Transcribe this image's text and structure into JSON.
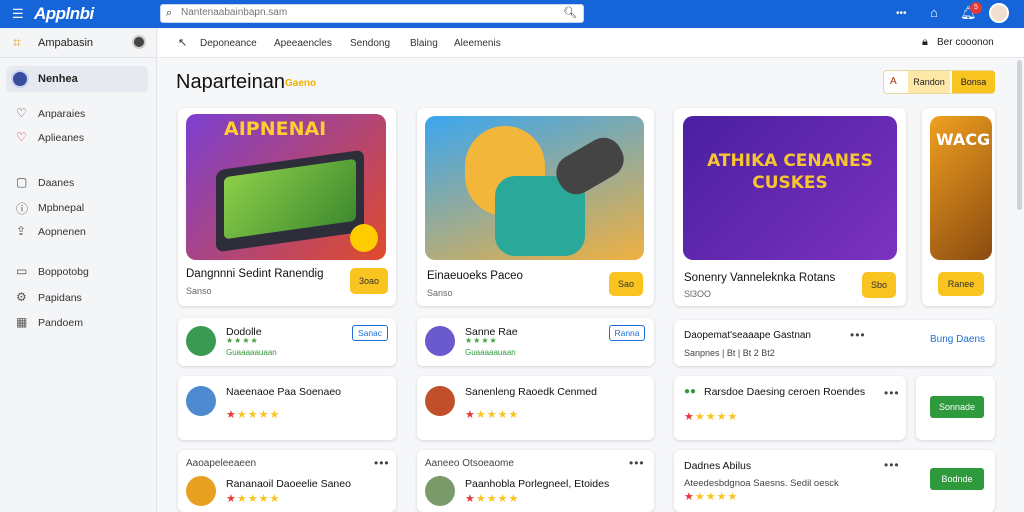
{
  "topbar": {
    "logo": "Applnbi",
    "search_placeholder": "Nantenaabainbapn.sam",
    "icons": [
      "menu-icon",
      "search-icon",
      "more-icon",
      "home-icon",
      "bell-icon",
      "avatar"
    ],
    "more": "•••",
    "bell_count": "5",
    "brand_color": "#1565d8"
  },
  "sidebar": {
    "header_label": "Ampabasin",
    "active_label": "Nenhea",
    "items": [
      {
        "label": "Anparaies",
        "icon": "heart-icon"
      },
      {
        "label": "Aplieanes",
        "icon": "heart-red-icon"
      },
      {
        "label": "Daanes",
        "icon": "box-icon"
      },
      {
        "label": "Mpbnepal",
        "icon": "info-icon"
      },
      {
        "label": "Aopnenen",
        "icon": "upload-icon"
      },
      {
        "label": "Boppotobg",
        "icon": "folder-icon"
      },
      {
        "label": "Papidans",
        "icon": "gear-icon"
      },
      {
        "label": "Pandoem",
        "icon": "calendar-icon"
      }
    ]
  },
  "subnav": {
    "tabs": [
      "Deponeance",
      "Apeeaencles",
      "Sendong",
      "Blaing",
      "Aleemenis"
    ],
    "right_label": "Ber cooonon"
  },
  "main": {
    "title": "Naparteinan",
    "title_badge": "Gaeno",
    "segment": {
      "icon_text": "A",
      "opt1": "Randon",
      "opt2": "Bonsa"
    }
  },
  "hero_cards": [
    {
      "image_text": "AIPNENAI",
      "title": "Dangnnni Sedint Ranendig",
      "sub": "Sanso",
      "button": "3oao"
    },
    {
      "image_text": "",
      "title": "Einaeuoeks Paceo",
      "sub": "Sanso",
      "button": "Sao"
    },
    {
      "image_text": "ATHIKA CENANES CUSKES",
      "title": "Sonenry Vanneleknka Rotans",
      "sub": "Sl3OO",
      "button": "Sbo"
    },
    {
      "image_text": "WACG",
      "title": "",
      "sub": "",
      "button": "Ranee"
    }
  ],
  "rows": [
    {
      "title": "Dodolle",
      "sub": "Guaaaaauaan",
      "button": "Sanac"
    },
    {
      "title": "Sanne Rae",
      "sub": "Guaaaaauaan",
      "button": "Ranna"
    },
    {
      "title": "Daopemat'seaaape Gastnan",
      "sub": "Sanpnes | Bt | Bt 2 Bt2",
      "link": "Bung Daens",
      "more": "•••"
    },
    {
      "title": "Naeenaoe Paa Soenaeo",
      "sub": "",
      "stars": "★★★★★"
    },
    {
      "title": "Sanenleng Raoedk Cenmed",
      "sub": "",
      "stars": "★★★★★"
    },
    {
      "title": "Rarsdoe Daesing ceroen Roendes",
      "button": "Sonnade",
      "more": "•••"
    },
    {
      "head": "Aaoapeleeaeen",
      "title": "Rananaoil Daoeelie Saneo",
      "more": "•••"
    },
    {
      "head": "Aaneeo Otsoeaome",
      "title": "Paanhobla Porlegneel, Etoides",
      "more": "•••"
    },
    {
      "head": "Dadnes Abilus",
      "title": "Ateedesbdgnoa Saesns. Sedil oesck",
      "button": "Bodnde",
      "more": "•••"
    }
  ]
}
